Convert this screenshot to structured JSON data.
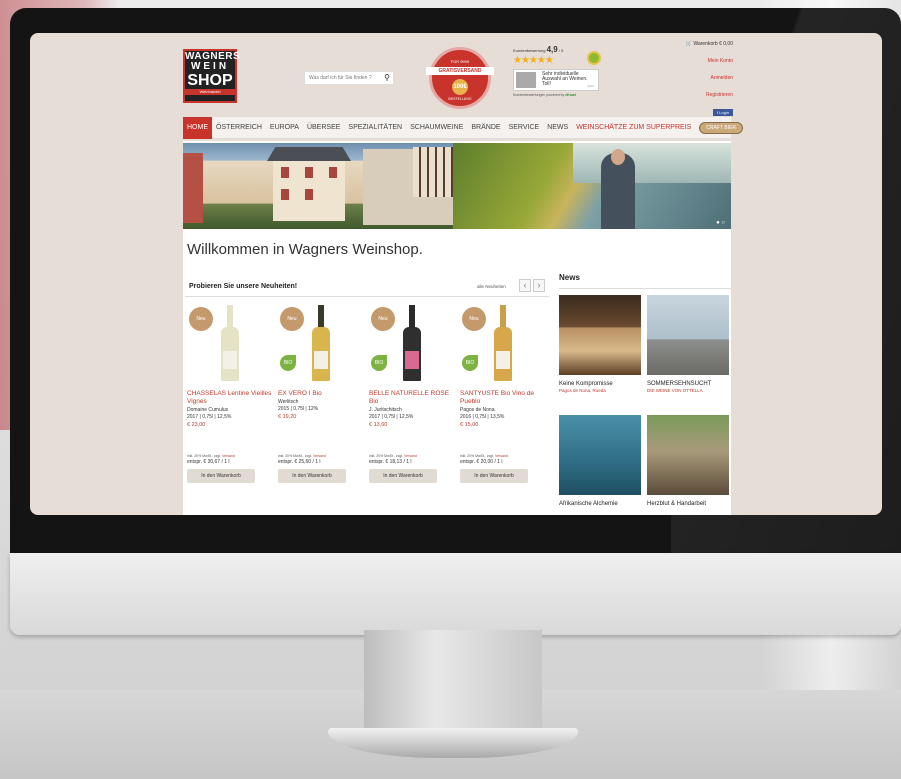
{
  "logo": {
    "line1": "WAGNERS",
    "line2": "WEIN",
    "line3": "SHOP",
    "tagline": "Weinhandel"
  },
  "search": {
    "placeholder": "Was darf ich für Sie finden ?",
    "icon": "search-icon"
  },
  "shipping_badge": {
    "top": "FÜR 9999",
    "main": "GRATISVERSAND",
    "amount": "100€",
    "bottom": "BESTELLUNG"
  },
  "rating": {
    "label": "Kundenbewertung",
    "score": "4,9",
    "max": "/ 5",
    "stars": "★★★★★",
    "review_text": "Sehr individuelle Auswahl an Weinen. Toll!",
    "review_source": "mehr...",
    "powered_label": "Kundenbewertungen powered by",
    "powered_brand": "eKomi"
  },
  "account": {
    "cart": "Warenkorb € 0,00",
    "my_account": "Mein Konto",
    "login": "Anmelden",
    "register": "Registrieren",
    "fb_login": "f Login"
  },
  "nav": {
    "items": [
      "HOME",
      "ÖSTERREICH",
      "EUROPA",
      "ÜBERSEE",
      "SPEZIALITÄTEN",
      "SCHAUMWEINE",
      "BRÄNDE",
      "SERVICE",
      "NEWS",
      "WEINSCHÄTZE ZUM SUPERPREIS"
    ],
    "craft": "CRAFT BIER"
  },
  "hero": {
    "dots": "● ○"
  },
  "welcome": "Willkommen in Wagners Weinshop.",
  "products_section": {
    "title": "Probieren Sie unsere Neuheiten!",
    "all_link": "alle Neuheiten",
    "prev": "‹",
    "next": "›"
  },
  "products": [
    {
      "badge": "Neu",
      "name": "CHASSELAS Lentine Vieilles Vignes",
      "producer": "Domaine Cumulus",
      "spec": "2017 | 0,75l | 12,5%",
      "price": "€ 23,00",
      "vat": "inkl. 20% MwSt., zzgl.",
      "vat_link": "Versand",
      "unit": "entspr. € 30,67 / 1 l",
      "button": "In den Warenkorb",
      "bio": "",
      "bottle_color": "#e6e2c6"
    },
    {
      "badge": "Neu",
      "name": "EX VERO I Bio",
      "producer": "Werlitsch",
      "spec": "2015 | 0,75l | 12%",
      "price": "€ 19,20",
      "vat": "inkl. 20% MwSt., zzgl.",
      "vat_link": "Versand",
      "unit": "entspr. € 25,60 / 1 l",
      "button": "In den Warenkorb",
      "bio": "BIO",
      "bottle_color": "#d9b54e"
    },
    {
      "badge": "Neu",
      "name": "BELLE NATURELLE ROSE Bio",
      "producer": "J. Juritschitsch",
      "spec": "2017 | 0,75l | 12,5%",
      "price": "€ 13,60",
      "vat": "inkl. 20% MwSt., zzgl.",
      "vat_link": "Versand",
      "unit": "entspr. € 18,13 / 1 l",
      "button": "In den Warenkorb",
      "bio": "BIO",
      "bottle_color": "#d86a92"
    },
    {
      "badge": "Neu",
      "name": "SANTYUSTE Bio Vino de Pueblo",
      "producer": "Pagos de Nona",
      "spec": "2016 | 0,75l | 13,5%",
      "price": "€ 15,00",
      "vat": "inkl. 20% MwSt., zzgl.",
      "vat_link": "Versand",
      "unit": "entspr. € 20,00 / 1 l",
      "button": "In den Warenkorb",
      "bio": "BIO",
      "bottle_color": "#d6a84b"
    }
  ],
  "news": {
    "title": "News",
    "cards": [
      {
        "title": "Keine Kompromisse",
        "subtitle": "Pagos de Nona, Rueda"
      },
      {
        "title": "SOMMERSEHNSUCHT",
        "subtitle": "DIE WEINE VON OTTELLA"
      },
      {
        "title": "Afrikanische Alchemie",
        "subtitle": ""
      },
      {
        "title": "Herzblut & Handarbeit",
        "subtitle": ""
      }
    ]
  }
}
